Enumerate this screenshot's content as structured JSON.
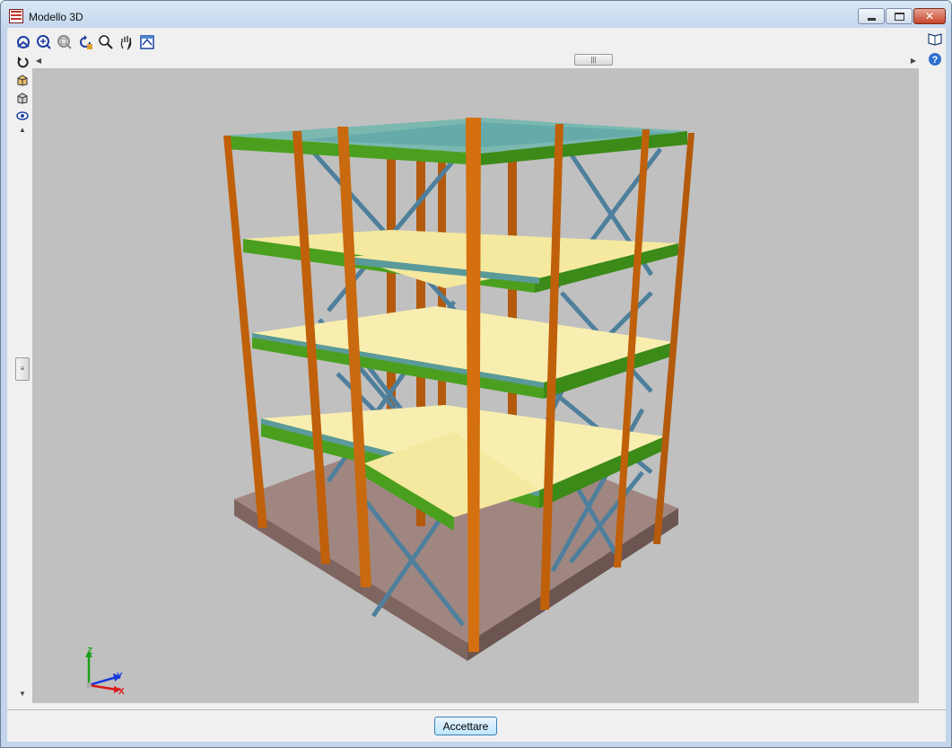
{
  "window": {
    "title": "Modello 3D"
  },
  "toolbar": {
    "icons": [
      "rotate-view-icon",
      "zoom-extents-icon",
      "zoom-window-icon",
      "redraw-icon",
      "zoom-icon",
      "pan-hand-icon",
      "view-options-icon"
    ]
  },
  "left_tools": {
    "icons": [
      "undo-view-icon",
      "solid-view-icon",
      "wireframe-view-icon",
      "visibility-icon"
    ]
  },
  "right_tools": {
    "icons": [
      "book-help-icon",
      "question-help-icon"
    ]
  },
  "axes": {
    "x": "X",
    "y": "Y",
    "z": "Z"
  },
  "colors": {
    "viewport_bg": "#c0c0c0",
    "column": "#c0600a",
    "beam": "#5a9a9a",
    "roof_beam": "#4aaa1e",
    "slab": "#f5e9a0",
    "brace": "#4a7a9a",
    "foundation": "#8e7872"
  },
  "footer": {
    "accept_label": "Accettare"
  }
}
